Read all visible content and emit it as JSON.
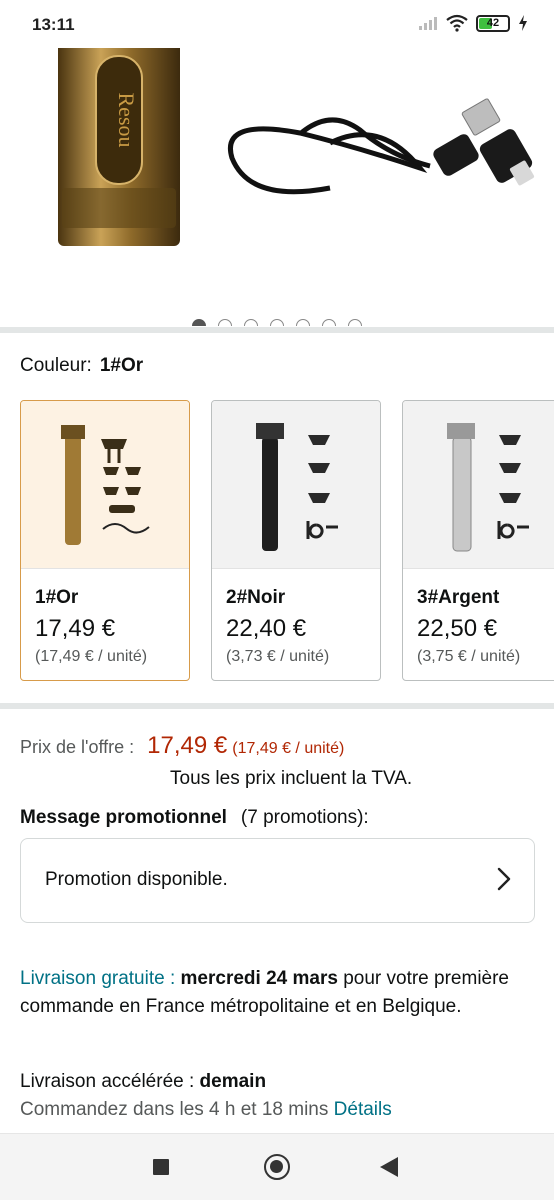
{
  "status_bar": {
    "time": "13:11",
    "battery": "42"
  },
  "gallery": {
    "image_count": 7,
    "active_index": 0
  },
  "color_selector": {
    "label": "Couleur:",
    "selected": "1#Or",
    "options": [
      {
        "name": "1#Or",
        "price": "17,49 €",
        "unit_price": "(17,49 € / unité)"
      },
      {
        "name": "2#Noir",
        "price": "22,40 €",
        "unit_price": "(3,73 € / unité)"
      },
      {
        "name": "3#Argent",
        "price": "22,50 €",
        "unit_price": "(3,75 € / unité)"
      }
    ]
  },
  "price": {
    "label": "Prix de l'offre :",
    "value": "17,49 €",
    "unit": "(17,49 € / unité)",
    "tax_note": "Tous les prix incluent la TVA."
  },
  "promotion": {
    "title": "Message promotionnel",
    "count": "(7 promotions):",
    "box_text": "Promotion disponible."
  },
  "delivery": {
    "free_label": "Livraison gratuite :",
    "free_date": "mercredi 24 mars",
    "free_rest": "pour votre première commande en France métropolitaine et en Belgique.",
    "fast_label": "Livraison accélérée :",
    "fast_date": "demain",
    "order_text": "Commandez dans les 4 h et 18 mins",
    "details_link": "Détails"
  },
  "colors": {
    "accent": "#b12704",
    "link": "#007185",
    "selected_border": "#d79b4a"
  }
}
